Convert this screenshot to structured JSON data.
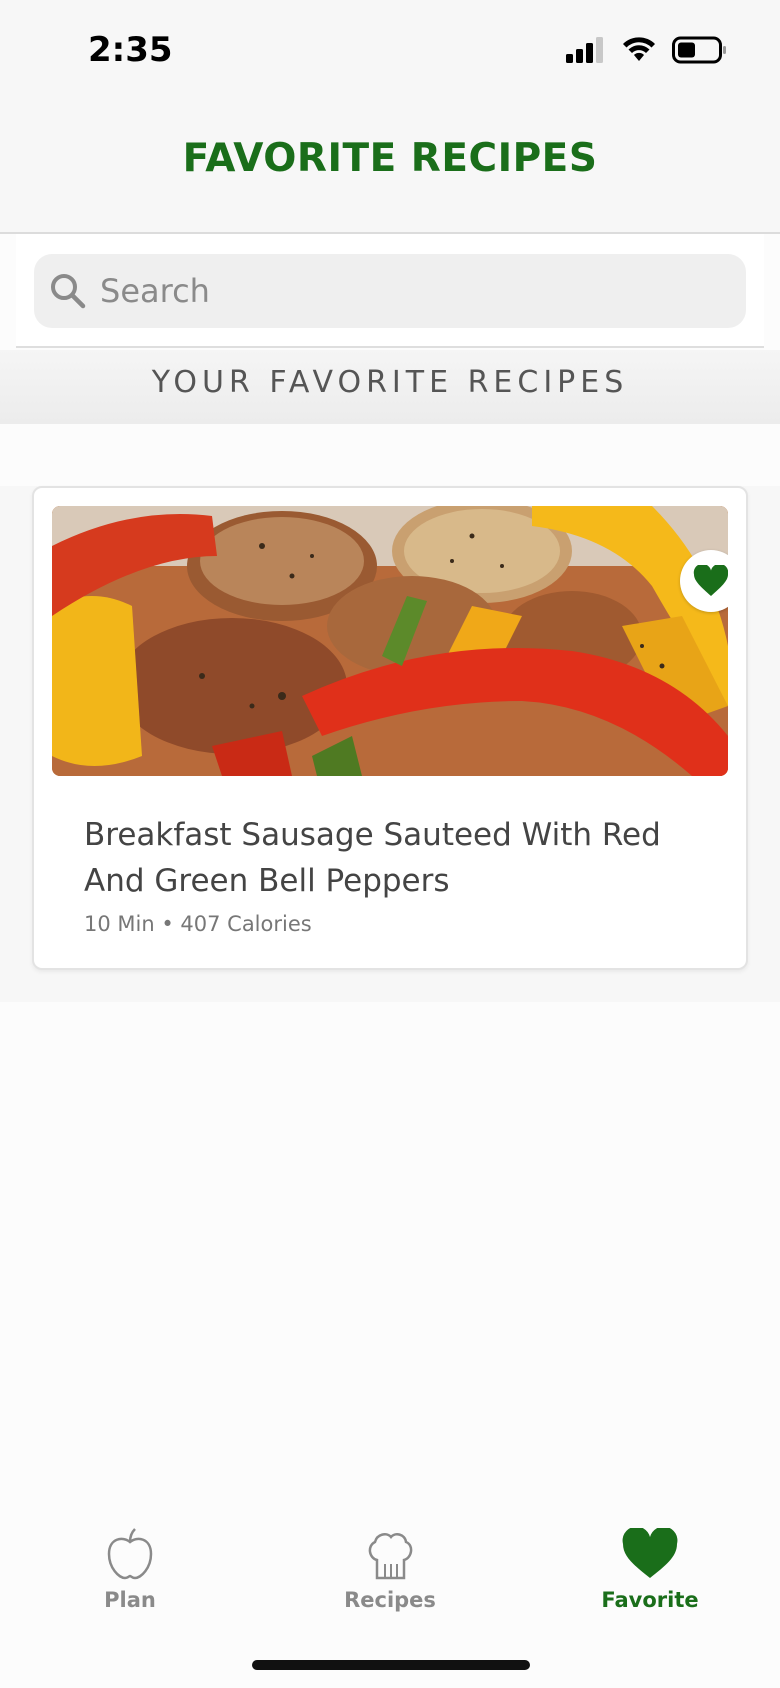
{
  "status_bar": {
    "time": "2:35",
    "icons": [
      "signal-icon",
      "wifi-icon",
      "battery-icon"
    ]
  },
  "header": {
    "title": "FAVORITE RECIPES",
    "title_color": "#1a6e1a"
  },
  "search": {
    "placeholder": "Search",
    "value": ""
  },
  "section": {
    "heading": "YOUR FAVORITE RECIPES"
  },
  "recipes": [
    {
      "title": "Breakfast Sausage Sauteed With Red And Green Bell Peppers",
      "meta": "10 Min • 407 Calories",
      "favorited": true,
      "image": "sausage-peppers-photo"
    }
  ],
  "tabs": [
    {
      "label": "Plan",
      "icon": "apple-icon",
      "active": false
    },
    {
      "label": "Recipes",
      "icon": "chef-hat-icon",
      "active": false
    },
    {
      "label": "Favorite",
      "icon": "heart-icon",
      "active": true
    }
  ],
  "colors": {
    "accent": "#1a6e1a",
    "inactive": "#8a8a8a"
  }
}
